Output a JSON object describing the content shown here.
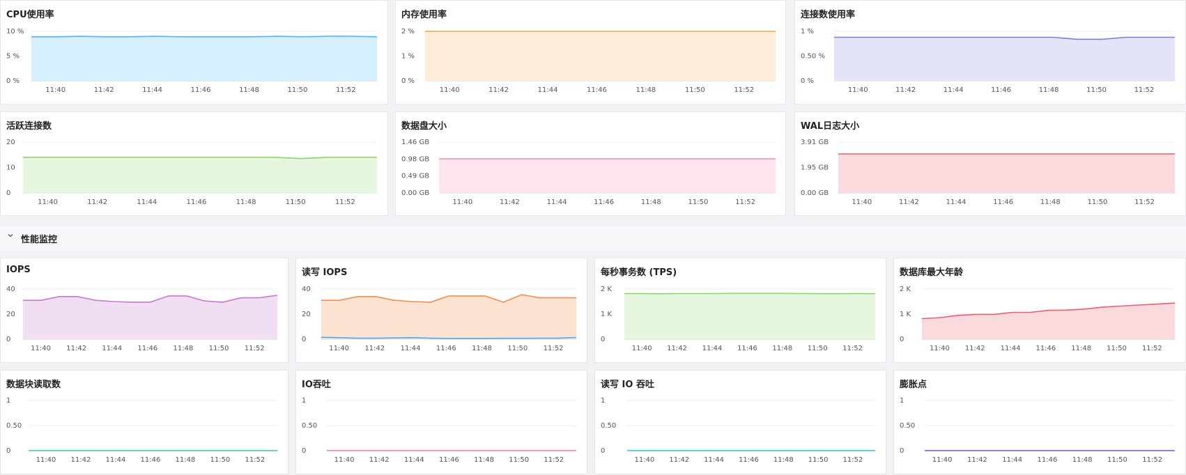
{
  "section": {
    "title": "性能监控",
    "chevron": "chevron-down-icon"
  },
  "x_ticks": [
    "11:40",
    "11:42",
    "11:44",
    "11:46",
    "11:48",
    "11:50",
    "11:52"
  ],
  "charts": [
    {
      "title": "CPU使用率",
      "chart_data": {
        "type": "area",
        "color": "#5ab4f0",
        "fill": "#d5effc",
        "y_ticks": [
          "0 %",
          "5 %",
          "10 %"
        ],
        "ylim": [
          0,
          10
        ],
        "series": [
          {
            "values": [
              8.9,
              8.9,
              9,
              8.9,
              8.9,
              9,
              8.9,
              8.9,
              8.9,
              8.9,
              9,
              8.9,
              9,
              9,
              8.9
            ]
          }
        ]
      }
    },
    {
      "title": "内存使用率",
      "chart_data": {
        "type": "area",
        "color": "#f0a34a",
        "fill": "#ffecd9",
        "y_ticks": [
          "0 %",
          "1 %",
          "2 %"
        ],
        "ylim": [
          0,
          2
        ],
        "series": [
          {
            "values": [
              2,
              2,
              2,
              2,
              2,
              2,
              2,
              2,
              2,
              2,
              2,
              2,
              2,
              2,
              2
            ]
          }
        ]
      }
    },
    {
      "title": "连接数使用率",
      "chart_data": {
        "type": "area",
        "color": "#7b7fdb",
        "fill": "#e4e4f8",
        "y_ticks": [
          "0 %",
          "0.50 %",
          "1 %"
        ],
        "ylim": [
          0,
          1
        ],
        "series": [
          {
            "values": [
              0.88,
              0.88,
              0.88,
              0.88,
              0.88,
              0.88,
              0.88,
              0.88,
              0.88,
              0.88,
              0.84,
              0.84,
              0.88,
              0.88,
              0.88
            ]
          }
        ]
      }
    },
    {
      "title": "活跃连接数",
      "chart_data": {
        "type": "area",
        "color": "#8fd46b",
        "fill": "#e7f6de",
        "y_ticks": [
          "0",
          "10",
          "20"
        ],
        "ylim": [
          0,
          20
        ],
        "series": [
          {
            "values": [
              14,
              14,
              14,
              14,
              14,
              14,
              14,
              14,
              14,
              14,
              14,
              13.5,
              14,
              14,
              14
            ]
          }
        ]
      }
    },
    {
      "title": "数据盘大小",
      "chart_data": {
        "type": "area",
        "color": "#ef8fb6",
        "fill": "#fde4ef",
        "y_ticks": [
          "0.00 GB",
          "0.49 GB",
          "0.98 GB",
          "1.46 GB"
        ],
        "ylim": [
          0,
          1.46
        ],
        "series": [
          {
            "values": [
              0.98,
              0.98,
              0.98,
              0.98,
              0.98,
              0.98,
              0.98,
              0.98,
              0.98,
              0.98,
              0.98,
              0.98,
              0.98,
              0.98,
              0.98
            ]
          }
        ]
      }
    },
    {
      "title": "WAL日志大小",
      "chart_data": {
        "type": "area",
        "color": "#e26071",
        "fill": "#fbdadd",
        "y_ticks": [
          "0.00 GB",
          "1.95 GB",
          "3.91 GB"
        ],
        "ylim": [
          0,
          3.91
        ],
        "series": [
          {
            "values": [
              3,
              3,
              3,
              3,
              3,
              3,
              3,
              3,
              3,
              3,
              3,
              3,
              3,
              3,
              3
            ]
          }
        ]
      }
    },
    {
      "title": "IOPS",
      "chart_data": {
        "type": "area",
        "color": "#c678cf",
        "fill": "#f2def3",
        "y_ticks": [
          "0",
          "20",
          "40"
        ],
        "ylim": [
          0,
          40
        ],
        "series": [
          {
            "values": [
              31,
              31,
              34,
              34,
              31,
              30,
              29.5,
              29.5,
              34.5,
              34.5,
              30.5,
              29.5,
              33,
              33,
              35
            ]
          }
        ]
      }
    },
    {
      "title": "读写 IOPS",
      "chart_data": {
        "type": "area",
        "color": "#f38d55",
        "fill": "#fde2d2",
        "y_ticks": [
          "0",
          "20",
          "40"
        ],
        "ylim": [
          0,
          40
        ],
        "series": [
          {
            "values": [
              31,
              31,
              34,
              34,
              31,
              30,
              29.5,
              34.5,
              34.5,
              34.5,
              29.5,
              35.5,
              33,
              33,
              33
            ],
            "color": "#f38d55"
          },
          {
            "values": [
              1.5,
              1.2,
              0.8,
              0.8,
              1,
              1.2,
              0.8,
              0.6,
              0.6,
              0.6,
              0.7,
              0.7,
              0.8,
              0.8,
              1.4
            ],
            "color": "#4aa8ef"
          }
        ]
      }
    },
    {
      "title": "每秒事务数 (TPS)",
      "chart_data": {
        "type": "area",
        "color": "#8fd46b",
        "fill": "#e7f6de",
        "y_ticks": [
          "0",
          "1 K",
          "2 K"
        ],
        "ylim": [
          0,
          2000
        ],
        "series": [
          {
            "values": [
              1820,
              1820,
              1810,
              1820,
              1820,
              1820,
              1825,
              1825,
              1825,
              1825,
              1820,
              1815,
              1815,
              1820,
              1815
            ]
          }
        ]
      }
    },
    {
      "title": "数据库最大年龄",
      "chart_data": {
        "type": "area",
        "color": "#e26071",
        "fill": "#fbdadd",
        "y_ticks": [
          "0",
          "1 K",
          "2 K"
        ],
        "ylim": [
          0,
          2000
        ],
        "series": [
          {
            "values": [
              820,
              860,
              950,
              990,
              990,
              1070,
              1070,
              1150,
              1160,
              1200,
              1280,
              1320,
              1360,
              1400,
              1440
            ]
          }
        ]
      }
    },
    {
      "title": "数据块读取数",
      "chart_data": {
        "type": "line",
        "color": "#3cc99a",
        "y_ticks": [
          "0",
          "0.50",
          "1"
        ],
        "ylim": [
          0,
          1
        ],
        "series": [
          {
            "values": [
              0,
              0,
              0,
              0,
              0,
              0,
              0,
              0,
              0,
              0,
              0,
              0,
              0,
              0,
              0
            ]
          }
        ]
      }
    },
    {
      "title": "IO吞吐",
      "chart_data": {
        "type": "line",
        "color": "#ef78b4",
        "y_ticks": [
          "0",
          "0.50",
          "1"
        ],
        "ylim": [
          0,
          1
        ],
        "series": [
          {
            "values": [
              0,
              0,
              0,
              0,
              0,
              0,
              0,
              0,
              0,
              0,
              0,
              0,
              0,
              0,
              0
            ]
          }
        ]
      }
    },
    {
      "title": "读写 IO 吞吐",
      "chart_data": {
        "type": "line",
        "color": "#24c3d2",
        "y_ticks": [
          "0",
          "0.50",
          "1"
        ],
        "ylim": [
          0,
          1
        ],
        "series": [
          {
            "values": [
              0,
              0,
              0,
              0,
              0,
              0,
              0,
              0,
              0,
              0,
              0,
              0,
              0,
              0,
              0
            ]
          }
        ]
      }
    },
    {
      "title": "膨胀点",
      "chart_data": {
        "type": "line",
        "color": "#5c5fd6",
        "y_ticks": [
          "0",
          "0.50",
          "1"
        ],
        "ylim": [
          0,
          1
        ],
        "series": [
          {
            "values": [
              0,
              0,
              0,
              0,
              0,
              0,
              0,
              0,
              0,
              0,
              0,
              0,
              0,
              0,
              0
            ]
          }
        ]
      }
    }
  ]
}
